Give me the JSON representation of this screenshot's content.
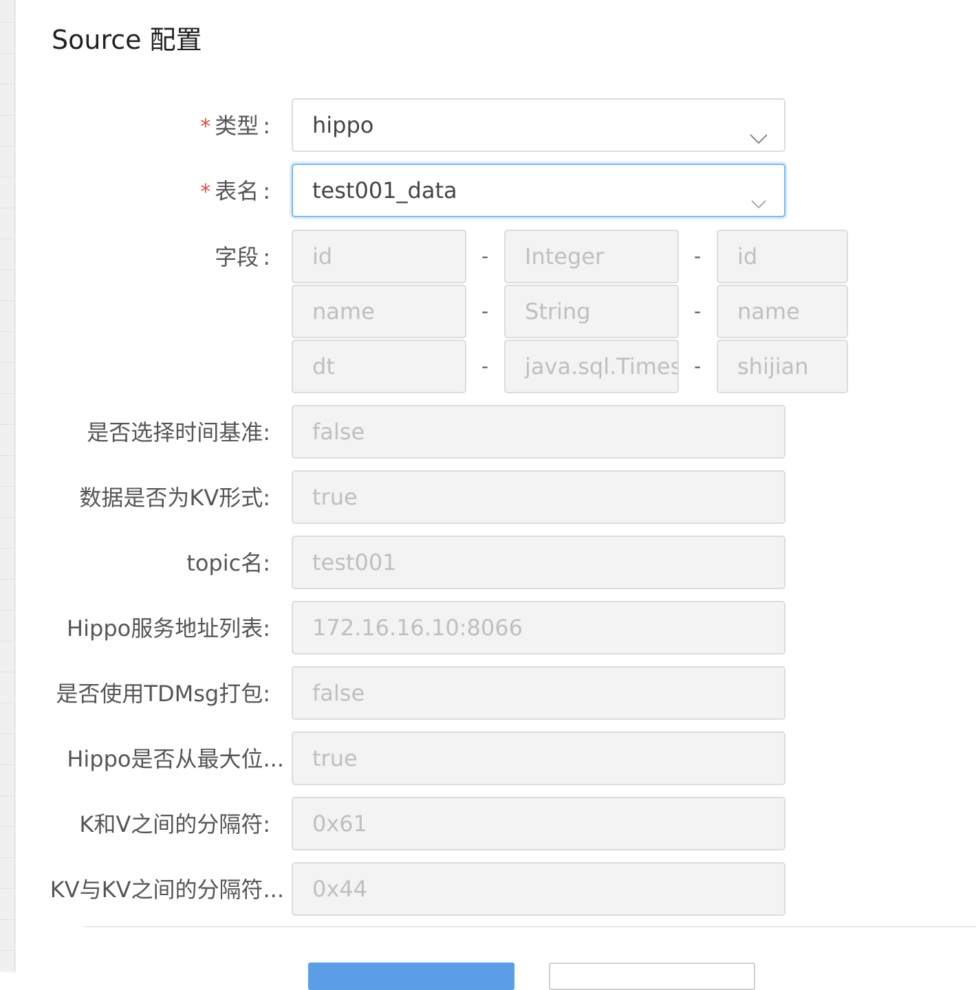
{
  "title": "Source 配置",
  "type_field": {
    "label": "类型",
    "value": "hippo"
  },
  "table_field": {
    "label": "表名",
    "value": "test001_data"
  },
  "fields": {
    "label": "字段",
    "rows": [
      {
        "name": "id",
        "type": "Integer",
        "alias": "id"
      },
      {
        "name": "name",
        "type": "String",
        "alias": "name"
      },
      {
        "name": "dt",
        "type": "java.sql.Times",
        "alias": "shijian"
      }
    ],
    "separator": "-"
  },
  "settings": [
    {
      "label": "是否选择时间基准:",
      "value": "false"
    },
    {
      "label": "数据是否为KV形式:",
      "value": "true"
    },
    {
      "label": "topic名:",
      "value": "test001"
    },
    {
      "label": "Hippo服务地址列表:",
      "value": "172.16.16.10:8066"
    },
    {
      "label": "是否使用TDMsg打包:",
      "value": "false"
    },
    {
      "label": "Hippo是否从最大位...",
      "value": "true"
    },
    {
      "label": "K和V之间的分隔符:",
      "value": "0x61"
    },
    {
      "label": "KV与KV之间的分隔符...",
      "value": "0x44"
    }
  ],
  "required_mark": "*",
  "colon": ":",
  "icons": {
    "dropdown": "chevron-down-icon"
  },
  "colors": {
    "accent": "#5b9de6",
    "required": "#e5483f",
    "focus_border": "#7eb8ee"
  }
}
